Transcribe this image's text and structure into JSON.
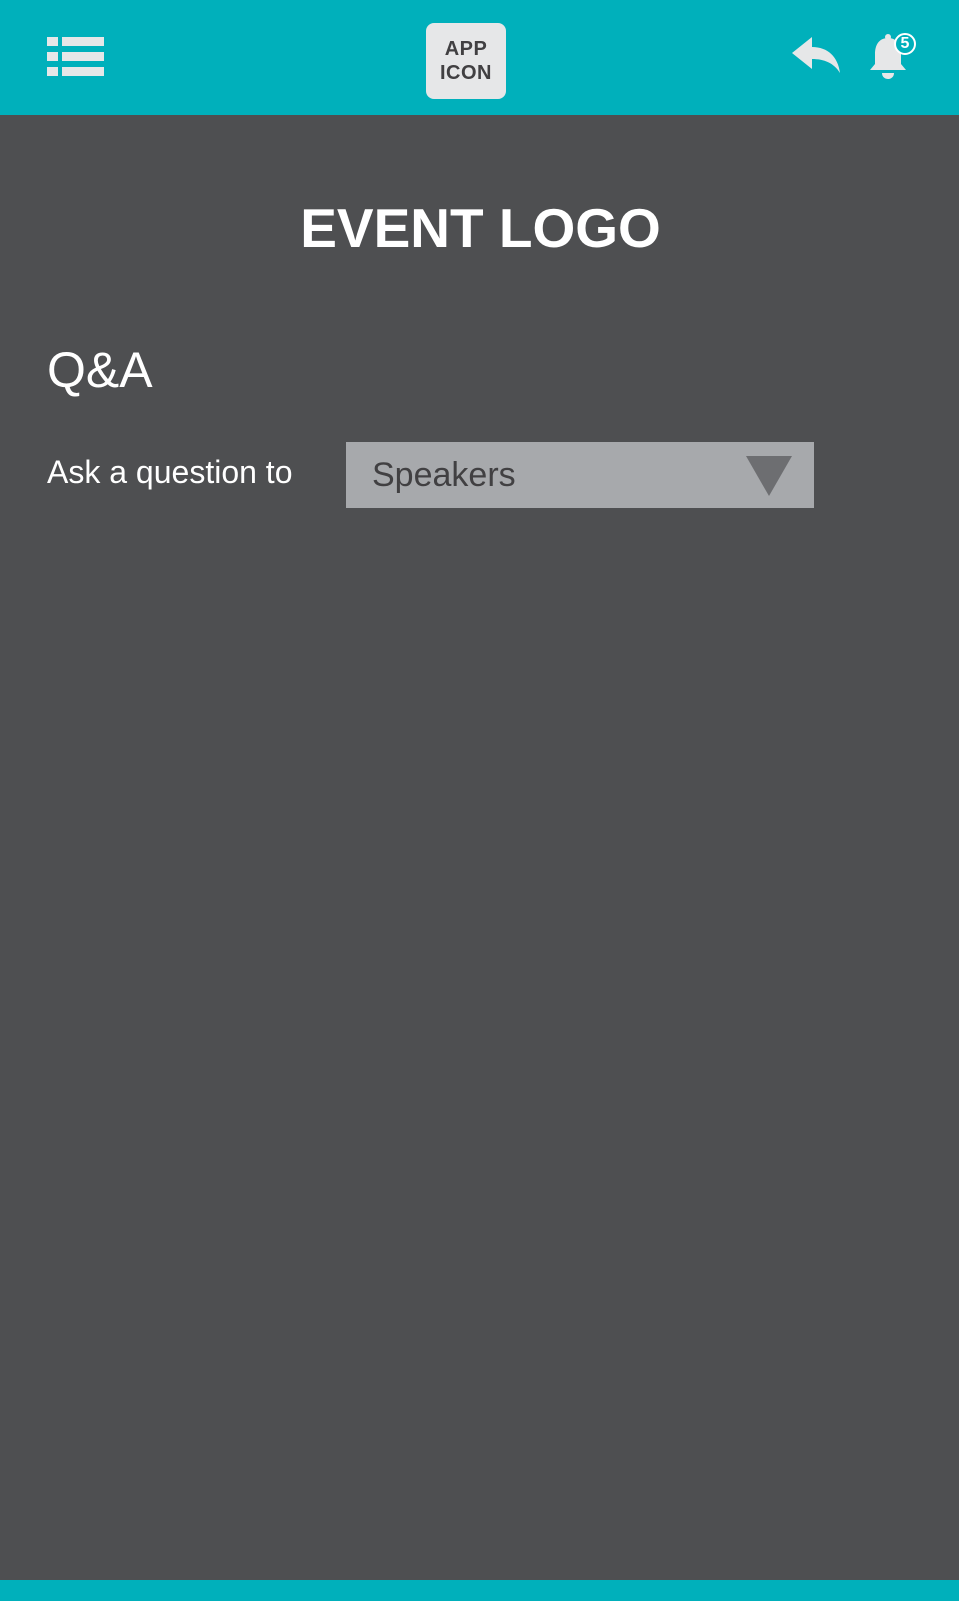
{
  "header": {
    "menu_icon": "list-menu-icon",
    "app_icon_line1": "APP",
    "app_icon_line2": "ICON",
    "back_icon": "reply-arrow-icon",
    "notifications_icon": "bell-icon",
    "notification_count": "5"
  },
  "main": {
    "event_logo": "EVENT LOGO",
    "title": "Q&A",
    "ask_label": "Ask a question to",
    "recipient_select": {
      "value": "Speakers",
      "arrow_icon": "triangle-down-icon"
    }
  },
  "colors": {
    "accent": "#00b0bb",
    "background": "#4e4f51",
    "select_bg": "#a7a9ac",
    "text_light": "#ffffff",
    "text_dark": "#414042"
  }
}
